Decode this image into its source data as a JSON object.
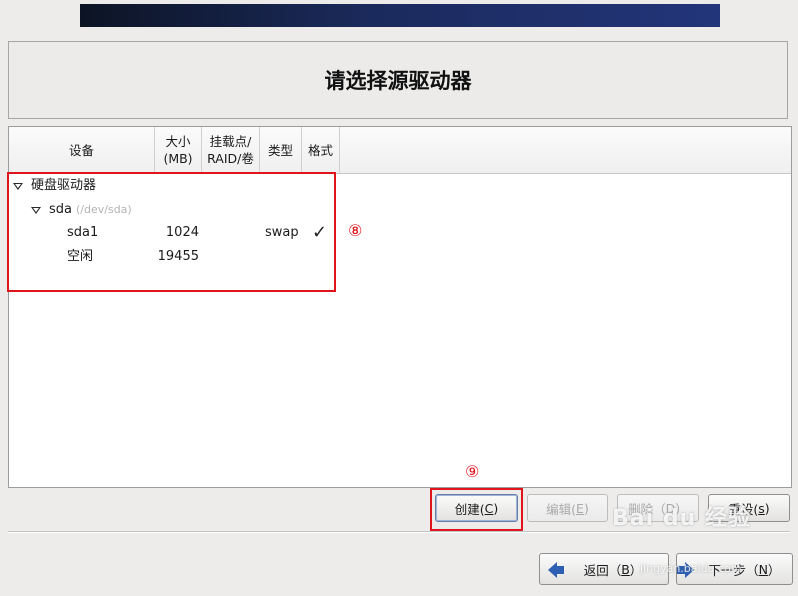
{
  "page_title": "请选择源驱动器",
  "columns": {
    "device": "设备",
    "size_line1": "大小",
    "size_line2": "(MB)",
    "mount_line1": "挂载点/",
    "mount_line2": "RAID/卷",
    "type": "类型",
    "format": "格式"
  },
  "tree": {
    "group_label": "硬盘驱动器",
    "disk_name": "sda",
    "disk_path": "(/dev/sda)",
    "partitions": [
      {
        "device": "sda1",
        "size": "1024",
        "type": "swap",
        "format": "✓"
      },
      {
        "device": "空闲",
        "size": "19455",
        "type": "",
        "format": ""
      }
    ]
  },
  "annotations": {
    "tree_marker": "⑧",
    "create_marker": "⑨"
  },
  "buttons": {
    "create": {
      "text": "创建(",
      "mnemonic": "C",
      "end": ")"
    },
    "edit": {
      "text": "编辑(",
      "mnemonic": "E",
      "end": ")"
    },
    "delete": {
      "text": "删除（",
      "mnemonic": "D",
      "end": "）"
    },
    "reset": {
      "text": "重设(",
      "mnemonic": "s",
      "end": ")"
    },
    "back": {
      "text": "返回（",
      "mnemonic": "B",
      "end": "）"
    },
    "next": {
      "text": "下一步（",
      "mnemonic": "N",
      "end": "）"
    }
  },
  "watermark": {
    "brand": "Bai du 经验",
    "url": "jingyan.baidu.com"
  },
  "colors": {
    "annotation_red": "#e0141b",
    "banner": "#1b2a5c"
  }
}
